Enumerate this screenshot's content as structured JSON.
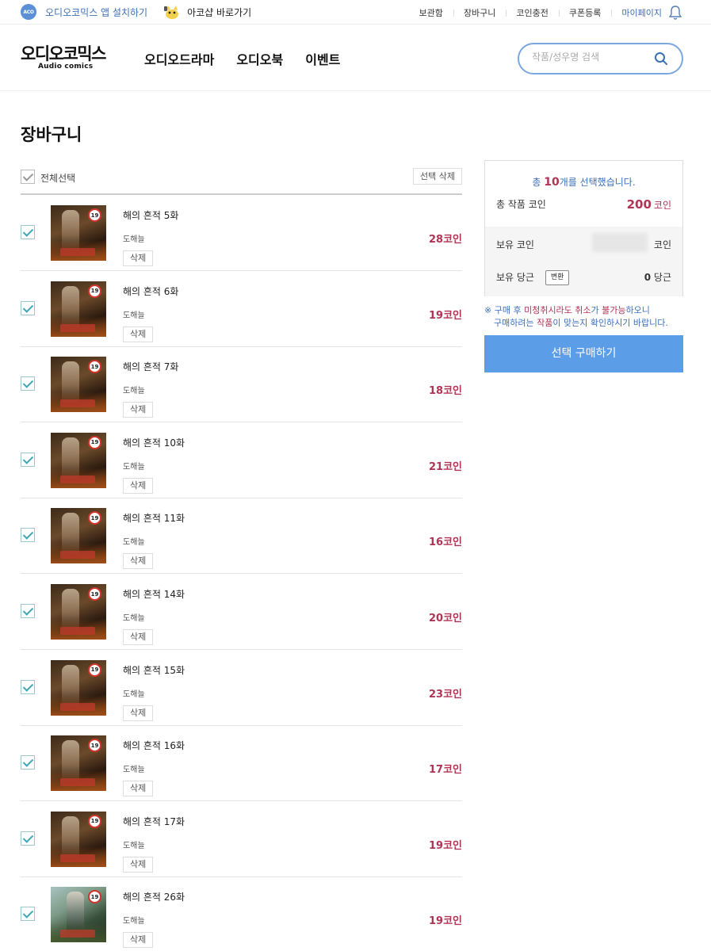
{
  "topbar": {
    "app_badge": "ACO",
    "app_install": "오디오코믹스 앱 설치하기",
    "shop_link": "아코샵 바로가기",
    "links": [
      "보관함",
      "장바구니",
      "코인충전",
      "쿠폰등록"
    ],
    "mypage": "마이페이지"
  },
  "header": {
    "logo_main": "오디오코믹스",
    "logo_sub": "Audio comics",
    "nav": [
      "오디오드라마",
      "오디오북",
      "이벤트"
    ],
    "search_placeholder": "작품/성우명 검색"
  },
  "page_title": "장바구니",
  "list": {
    "select_all": "전체선택",
    "delete_selected": "선택 삭제",
    "delete_label": "삭제",
    "age_badge": "19",
    "items": [
      {
        "title": "해의 흔적 5화",
        "author": "도해늘",
        "price": "28코인",
        "checked": true,
        "thumb": "dark"
      },
      {
        "title": "해의 흔적 6화",
        "author": "도해늘",
        "price": "19코인",
        "checked": true,
        "thumb": "dark"
      },
      {
        "title": "해의 흔적 7화",
        "author": "도해늘",
        "price": "18코인",
        "checked": true,
        "thumb": "dark"
      },
      {
        "title": "해의 흔적 10화",
        "author": "도해늘",
        "price": "21코인",
        "checked": true,
        "thumb": "dark"
      },
      {
        "title": "해의 흔적 11화",
        "author": "도해늘",
        "price": "16코인",
        "checked": true,
        "thumb": "dark"
      },
      {
        "title": "해의 흔적 14화",
        "author": "도해늘",
        "price": "20코인",
        "checked": true,
        "thumb": "dark"
      },
      {
        "title": "해의 흔적 15화",
        "author": "도해늘",
        "price": "23코인",
        "checked": true,
        "thumb": "dark"
      },
      {
        "title": "해의 흔적 16화",
        "author": "도해늘",
        "price": "17코인",
        "checked": true,
        "thumb": "dark"
      },
      {
        "title": "해의 흔적 17화",
        "author": "도해늘",
        "price": "19코인",
        "checked": true,
        "thumb": "dark"
      },
      {
        "title": "해의 흔적 26화",
        "author": "도해늘",
        "price": "19코인",
        "checked": true,
        "thumb": "light"
      }
    ]
  },
  "summary": {
    "head_prefix": "총 ",
    "head_count": "10",
    "head_suffix": "개를 선택했습니다.",
    "total_label": "총 작품 코인",
    "total_value": "200",
    "coin_unit": "코인",
    "owned_coin_label": "보유 코인",
    "owned_coin_unit": "코인",
    "owned_carrot_label": "보유 당근",
    "convert_button": "변환",
    "owned_carrot_value": "0",
    "carrot_unit": "당근"
  },
  "notice": {
    "line1_a": "※ 구매 후 ",
    "line1_b": "미청취시라도 취소",
    "line1_c": "가 ",
    "line1_d": "불가능",
    "line1_e": "하오니",
    "line2_a": "구매하려는 ",
    "line2_b": "작품",
    "line2_c": "이 맞는지 확인하시기 바랍니다."
  },
  "buy_button": "선택 구매하기",
  "colors": {
    "accent_blue": "#3d6fb8",
    "price_red": "#b03456",
    "buy_button": "#5b9de6",
    "check_teal": "#3fa7b5"
  }
}
